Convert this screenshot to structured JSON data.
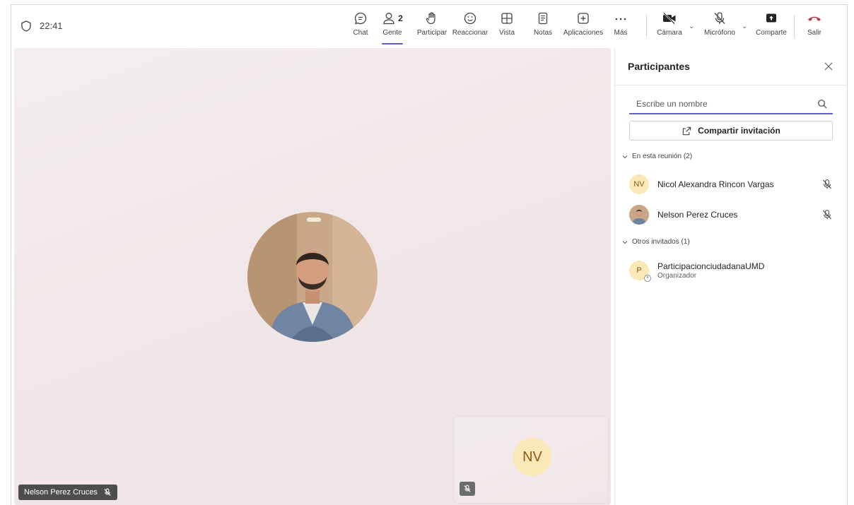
{
  "topbar": {
    "time": "22:41",
    "buttons": {
      "chat": "Chat",
      "people": "Gente",
      "people_count": "2",
      "raise_hand": "Participar",
      "react": "Reaccionar",
      "view": "Vista",
      "notes": "Notas",
      "apps": "Aplicaciones",
      "more": "Más",
      "camera": "Cámara",
      "mic": "Micrófono",
      "share": "Comparte",
      "leave": "Salir"
    },
    "accent": "#5b5fc7",
    "leave_color": "#c4314b"
  },
  "stage": {
    "speaker_name": "Nelson Perez Cruces",
    "self_initials": "NV"
  },
  "panel": {
    "title": "Participantes",
    "search_placeholder": "Escribe un nombre",
    "share_invite": "Compartir invitación",
    "in_meeting_label": "En esta reunión (2)",
    "participants": [
      {
        "initials": "NV",
        "name": "Nicol Alexandra Rincon Vargas",
        "muted": true
      },
      {
        "initials": "",
        "name": "Nelson Perez Cruces",
        "muted": true
      }
    ],
    "others_label": "Otros invitados (1)",
    "invited": [
      {
        "initials": "P",
        "name": "ParticipacionciudadanaUMD",
        "role": "Organizador"
      }
    ]
  }
}
